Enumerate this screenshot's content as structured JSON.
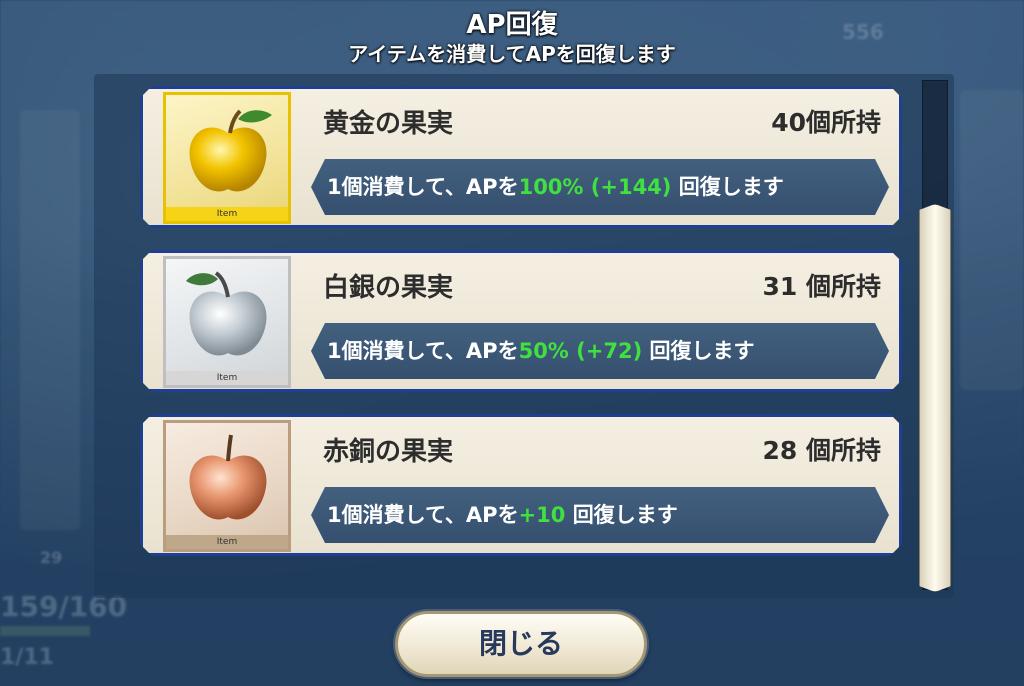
{
  "header": {
    "title": "AP回復",
    "subtitle": "アイテムを消費してAPを回復します"
  },
  "items": [
    {
      "name": "黄金の果実",
      "count": "40個所持",
      "tag": "Item",
      "icon": "golden-apple-icon",
      "desc_prefix": "1個消費して、APを",
      "desc_highlight": "100% (+144)",
      "desc_suffix": " 回復します"
    },
    {
      "name": "白銀の果実",
      "count": "31 個所持",
      "tag": "Item",
      "icon": "silver-apple-icon",
      "desc_prefix": "1個消費して、APを",
      "desc_highlight": "50% (+72)",
      "desc_suffix": " 回復します"
    },
    {
      "name": "赤銅の果実",
      "count": "28 個所持",
      "tag": "Item",
      "icon": "bronze-apple-icon",
      "desc_prefix": "1個消費して、APを",
      "desc_highlight": "+10",
      "desc_suffix": " 回復します"
    }
  ],
  "close_button": {
    "label": "閉じる"
  },
  "colors": {
    "highlight": "#3fe03f",
    "card_border": "#1f3f95",
    "gold": "#e6c200",
    "silver": "#bfbfbf",
    "bronze": "#b99d7f"
  },
  "background": {
    "stat_1": "556",
    "stat_2": "29",
    "stat_3": "159/160",
    "stat_4": "1/11"
  }
}
